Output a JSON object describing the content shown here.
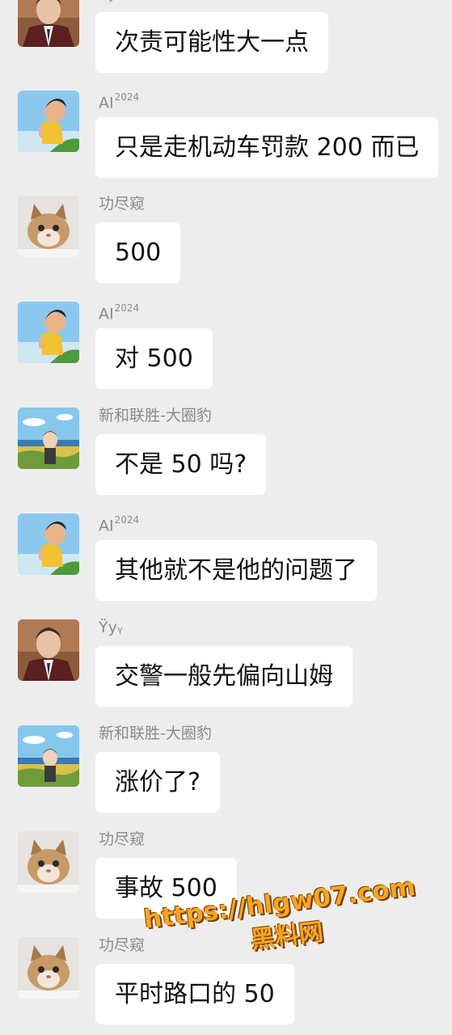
{
  "messages": [
    {
      "sender": "Ÿyᵧ",
      "sender_sup": "",
      "avatar": "avatar-young-man-in-suit",
      "text": "次责可能性大一点"
    },
    {
      "sender": "AI",
      "sender_sup": "2024",
      "avatar": "avatar-cartoon-boy",
      "text": "只是走机动车罚款 200 而已"
    },
    {
      "sender": "功尽窥",
      "sender_sup": "",
      "avatar": "avatar-kitten",
      "text": "500"
    },
    {
      "sender": "AI",
      "sender_sup": "2024",
      "avatar": "avatar-cartoon-boy",
      "text": "对 500"
    },
    {
      "sender": "新和联胜-大圈豹",
      "sender_sup": "",
      "avatar": "avatar-cartoon-field",
      "text": "不是 50 吗?"
    },
    {
      "sender": "AI",
      "sender_sup": "2024",
      "avatar": "avatar-cartoon-boy",
      "text": "其他就不是他的问题了"
    },
    {
      "sender": "Ÿyᵧ",
      "sender_sup": "",
      "avatar": "avatar-young-man-in-suit",
      "text": "交警一般先偏向山姆"
    },
    {
      "sender": "新和联胜-大圈豹",
      "sender_sup": "",
      "avatar": "avatar-cartoon-field",
      "text": "涨价了?"
    },
    {
      "sender": "功尽窥",
      "sender_sup": "",
      "avatar": "avatar-kitten",
      "text": "事故 500"
    },
    {
      "sender": "功尽窥",
      "sender_sup": "",
      "avatar": "avatar-kitten",
      "text": "平时路口的 50"
    }
  ],
  "watermark": {
    "url": "https://hlgw07.com",
    "site": "黑料网"
  },
  "colors": {
    "background": "#ededed",
    "bubble": "#ffffff",
    "name": "#8a8a8a",
    "watermark": "#f6a623"
  }
}
